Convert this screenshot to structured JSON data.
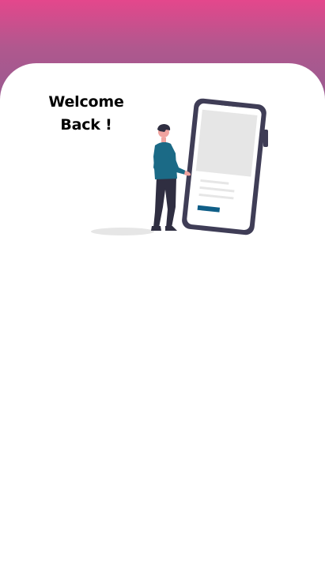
{
  "header": {
    "gradient_top": "#e4478c",
    "gradient_bottom": "#9b5a90"
  },
  "card": {
    "background": "#ffffff"
  },
  "welcome": {
    "line1": "Welcome",
    "line2": "Back !"
  },
  "illustration": {
    "name": "person-with-phone-illustration",
    "colors": {
      "phone_frame": "#3f3d56",
      "screen_block": "#e6e6e6",
      "accent": "#0f5e87",
      "shirt": "#1b6a86",
      "skin": "#f0a4a0",
      "hair": "#2f2e41",
      "shadow": "#e6e6e6"
    }
  }
}
